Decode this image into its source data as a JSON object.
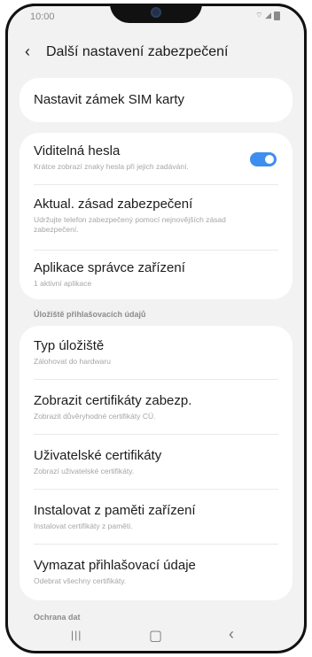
{
  "status": {
    "time": "10:00",
    "icons": "⌔ ◢"
  },
  "header": {
    "back_icon": "‹",
    "title": "Další nastavení zabezpečení"
  },
  "sim": {
    "title": "Nastavit zámek SIM karty"
  },
  "security": [
    {
      "title": "Viditelná hesla",
      "subtitle": "Krátce zobrazí znaky hesla při jejich zadávání.",
      "toggle": true
    },
    {
      "title": "Aktual. zásad zabezpečení",
      "subtitle": "Udržujte telefon zabezpečený pomocí nejnovějších zásad zabezpečení."
    },
    {
      "title": "Aplikace správce zařízení",
      "subtitle": "1 aktivní aplikace"
    }
  ],
  "storage_section": {
    "label": "Úložiště přihlašovacích údajů"
  },
  "storage": [
    {
      "title": "Typ úložiště",
      "subtitle": "Zálohovat do hardwaru"
    },
    {
      "title": "Zobrazit certifikáty zabezp.",
      "subtitle": "Zobrazit důvěryhodné certifikáty CÚ."
    },
    {
      "title": "Uživatelské certifikáty",
      "subtitle": "Zobrazí uživatelské certifikáty."
    },
    {
      "title": "Instalovat z paměti zařízení",
      "subtitle": "Instalovat certifikáty z paměti."
    },
    {
      "title": "Vymazat přihlašovací údaje",
      "subtitle": "Odebrat všechny certifikáty."
    }
  ],
  "data_section": {
    "label": "Ochrana dat"
  },
  "navbar": {
    "recent": "|||",
    "home": "▢",
    "back": "‹"
  },
  "colors": {
    "accent": "#3d8ef0",
    "background": "#f2f2f2"
  }
}
